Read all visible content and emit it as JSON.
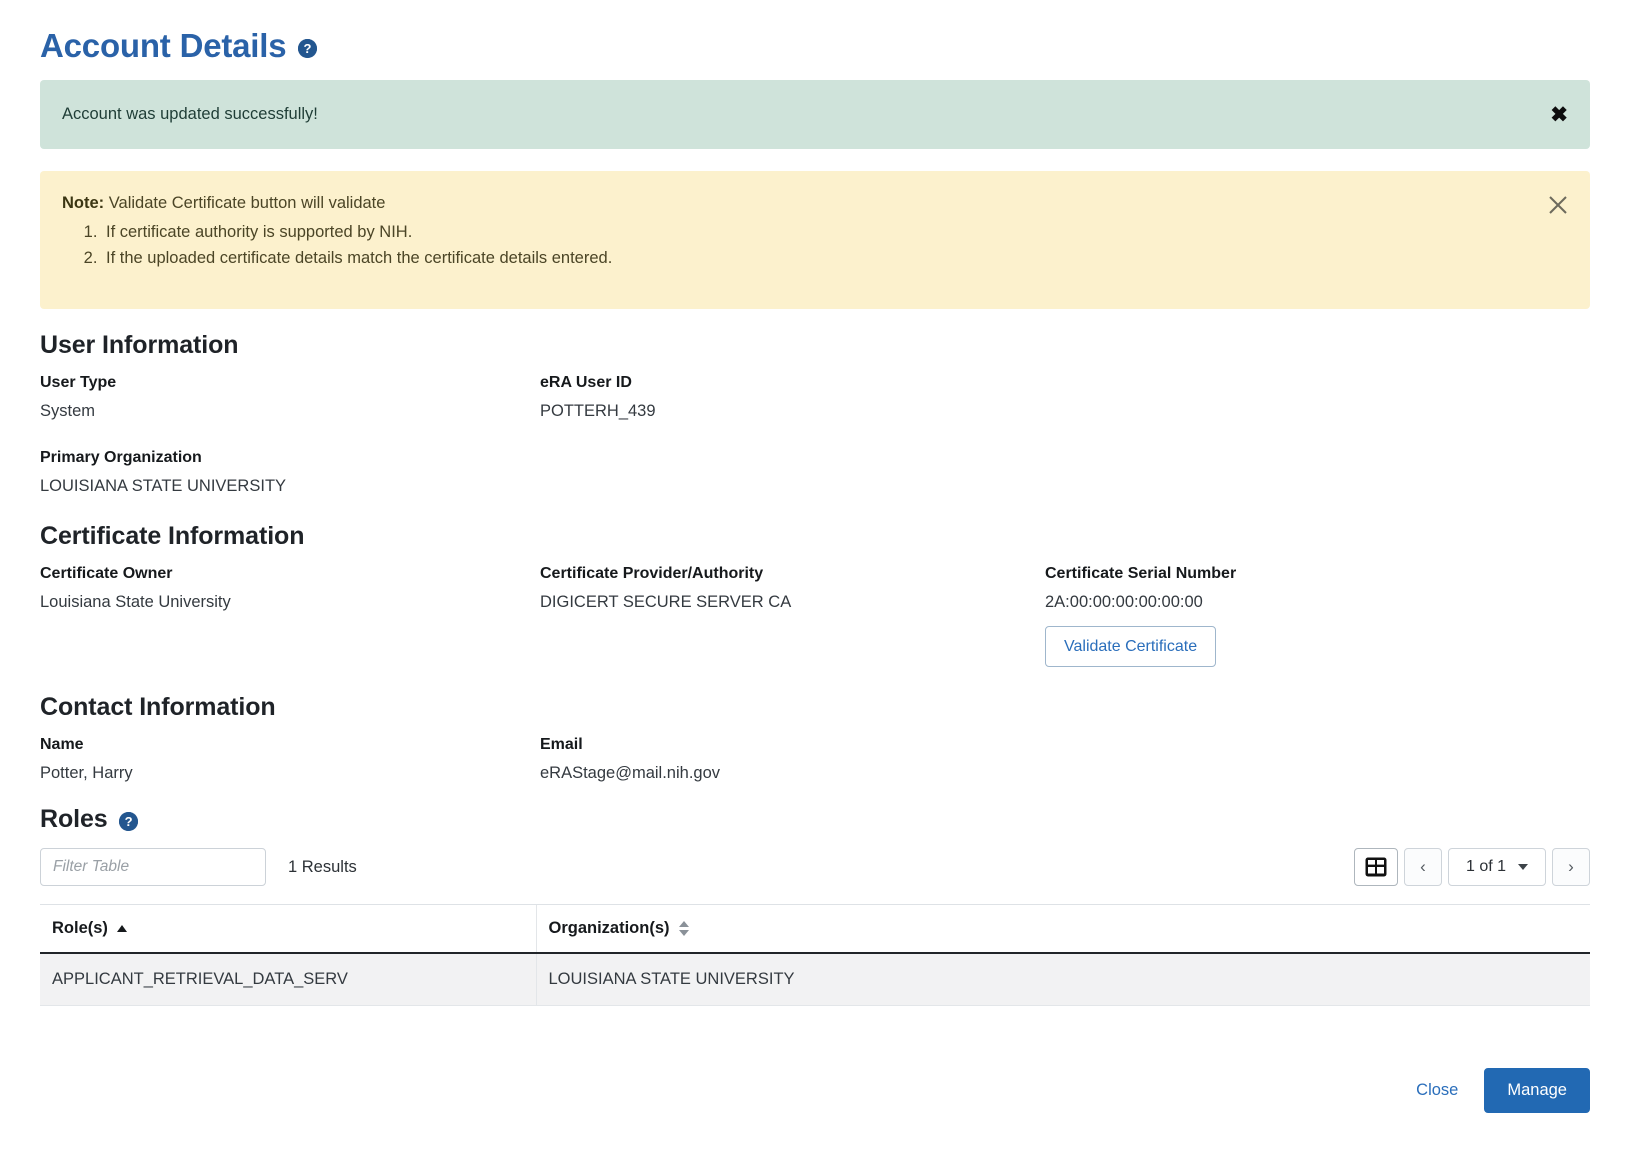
{
  "header": {
    "title": "Account Details",
    "help_icon": "help-circle-icon"
  },
  "alerts": {
    "success": {
      "message": "Account was updated successfully!",
      "close_label": "✖",
      "background": "#cfe3da"
    },
    "note": {
      "label": "Note:",
      "lead": "Validate Certificate button will validate",
      "items": [
        "If certificate authority is supported by NIH.",
        "If the uploaded certificate details match the certificate details entered."
      ],
      "background": "#fcf1cd"
    }
  },
  "user_information": {
    "title": "User Information",
    "fields": [
      {
        "label": "User Type",
        "value": "System"
      },
      {
        "label": "eRA User ID",
        "value": "POTTERH_439"
      },
      {
        "label": "Primary Organization",
        "value": "LOUISIANA STATE UNIVERSITY"
      }
    ]
  },
  "certificate_information": {
    "title": "Certificate Information",
    "fields": [
      {
        "label": "Certificate Owner",
        "value": "Louisiana State University"
      },
      {
        "label": "Certificate Provider/Authority",
        "value": "DIGICERT SECURE SERVER CA"
      },
      {
        "label": "Certificate Serial Number",
        "value": "2A:00:00:00:00:00:00"
      }
    ],
    "validate_button": "Validate Certificate"
  },
  "contact_information": {
    "title": "Contact Information",
    "fields": [
      {
        "label": "Name",
        "value": "Potter, Harry"
      },
      {
        "label": "Email",
        "value": "eRAStage@mail.nih.gov"
      }
    ]
  },
  "roles": {
    "title": "Roles",
    "help_icon": "help-circle-icon",
    "filter_placeholder": "Filter Table",
    "filter_value": "",
    "results_text": "1 Results",
    "toolbar": {
      "grid_icon": "table-grid-icon",
      "prev_label": "‹",
      "next_label": "›",
      "page_indicator": "1 of 1"
    },
    "columns": [
      {
        "label": "Role(s)",
        "sort": "asc"
      },
      {
        "label": "Organization(s)",
        "sort": "none"
      }
    ],
    "rows": [
      {
        "role": "APPLICANT_RETRIEVAL_DATA_SERV",
        "organization": "LOUISIANA STATE UNIVERSITY"
      }
    ]
  },
  "footer": {
    "close_label": "Close",
    "manage_label": "Manage",
    "primary_color": "#2269b3"
  }
}
